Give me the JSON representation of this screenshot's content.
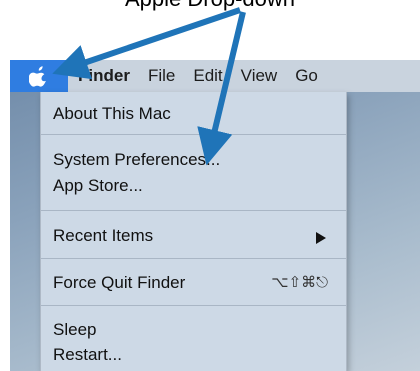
{
  "caption": "Apple Drop-down",
  "menubar": {
    "apple_icon": "apple-icon",
    "items": [
      "Finder",
      "File",
      "Edit",
      "View",
      "Go"
    ]
  },
  "apple_menu": {
    "items": [
      {
        "label": "About This Mac"
      },
      {
        "label": "System Preferences..."
      },
      {
        "label": "App Store..."
      },
      {
        "label": "Recent Items",
        "submenu_icon": "triangle-right-icon"
      },
      {
        "label": "Force Quit Finder",
        "shortcut": "⌥⇧⌘⎋"
      },
      {
        "label": "Sleep"
      },
      {
        "label": "Restart..."
      }
    ]
  },
  "annotation": {
    "arrow_color": "#1f74b8"
  },
  "colors": {
    "menu_highlight": "#2f7de1",
    "menu_bg": "#cdd9e6"
  }
}
